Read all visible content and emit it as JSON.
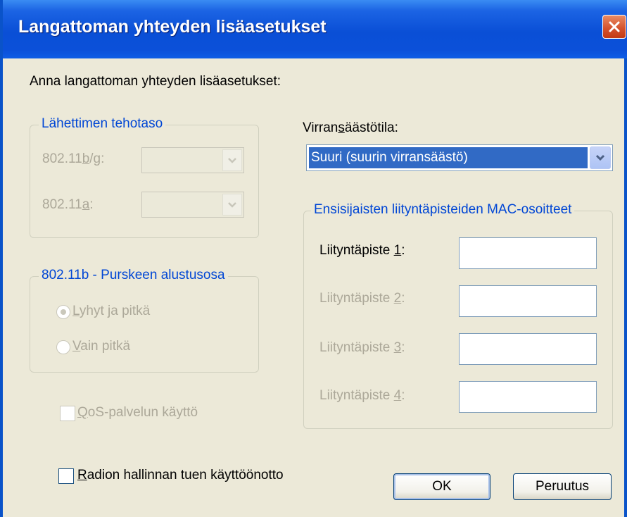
{
  "window": {
    "title": "Langattoman yhteyden lisäasetukset"
  },
  "intro": "Anna langattoman yhteyden lisäasetukset:",
  "power_group": {
    "legend": "Lähettimen tehotaso",
    "bg_label": [
      "802.11",
      "b",
      "/g:"
    ],
    "a_label": [
      "802.11",
      "a",
      ":"
    ]
  },
  "preamble_group": {
    "legend": "802.11b - Purskeen alustusosa",
    "options": [
      {
        "label": [
          "",
          "L",
          "yhyt ja pitkä"
        ],
        "selected": true
      },
      {
        "label": [
          "",
          "V",
          "ain pitkä"
        ],
        "selected": false
      }
    ]
  },
  "qos": {
    "label": [
      "",
      "Q",
      "oS-palvelun käyttö"
    ],
    "checked": false
  },
  "radio_mgmt": {
    "label": [
      "",
      "R",
      "adion hallinnan tuen käyttöönotto"
    ],
    "checked": false
  },
  "power_save": {
    "label": [
      "Virran",
      "s",
      "äästötila:"
    ],
    "value": "Suuri (suurin virransäästö)"
  },
  "mac_group": {
    "legend": "Ensisijaisten liityntäpisteiden MAC-osoitteet",
    "items": [
      {
        "label": [
          "Liityntäpiste ",
          "1",
          ":"
        ],
        "value": ""
      },
      {
        "label": [
          "Liityntäpiste ",
          "2",
          ":"
        ],
        "value": ""
      },
      {
        "label": [
          "Liityntäpiste ",
          "3",
          ":"
        ],
        "value": ""
      },
      {
        "label": [
          "Liityntäpiste ",
          "4",
          ":"
        ],
        "value": ""
      }
    ]
  },
  "buttons": {
    "ok": "OK",
    "cancel": "Peruutus"
  },
  "colors": {
    "title_bar": "#0a4fd6",
    "legend_text": "#0046d5",
    "selection": "#316ac5",
    "close_button": "#d3502b"
  }
}
